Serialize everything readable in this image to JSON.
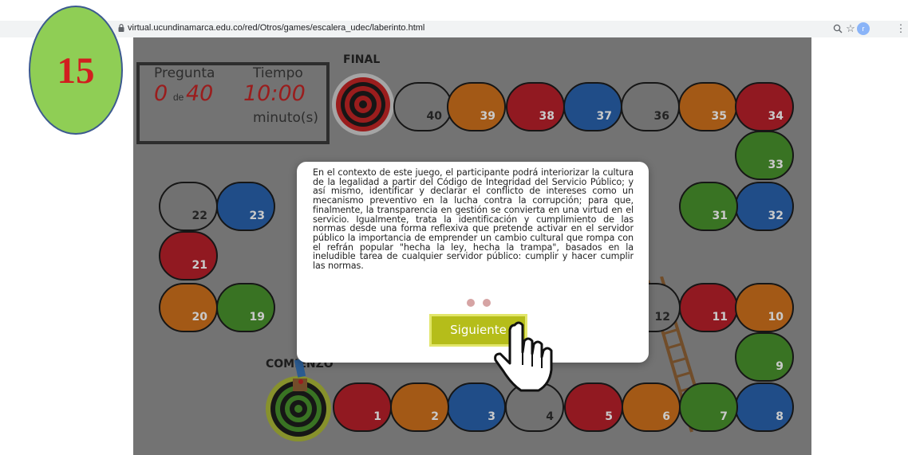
{
  "browser": {
    "url": "virtual.ucundinamarca.edu.co/red/Otros/games/escalera_udec/laberinto.html",
    "avatar_letter": "r"
  },
  "step_badge": "15",
  "scoreboard": {
    "pregunta_label": "Pregunta",
    "tiempo_label": "Tiempo",
    "current_question": "0",
    "de": "de",
    "total_questions": "40",
    "time": "10:00",
    "time_unit": "minuto(s)"
  },
  "board": {
    "final_label": "FINAL",
    "comienzo_label": "COMIENZO",
    "colors": {
      "red": "#b5141f",
      "orange": "#cc6a10",
      "blue": "#1e5aa8",
      "green": "#3f8c22",
      "gray": "#8a8a8a"
    },
    "cells": [
      {
        "n": "40",
        "c": "gray"
      },
      {
        "n": "39",
        "c": "orange"
      },
      {
        "n": "38",
        "c": "red"
      },
      {
        "n": "37",
        "c": "blue"
      },
      {
        "n": "36",
        "c": "gray"
      },
      {
        "n": "35",
        "c": "orange"
      },
      {
        "n": "34",
        "c": "red"
      },
      {
        "n": "33",
        "c": "green"
      },
      {
        "n": "32",
        "c": "blue"
      },
      {
        "n": "31",
        "c": "green"
      },
      {
        "n": "23",
        "c": "blue"
      },
      {
        "n": "22",
        "c": "gray"
      },
      {
        "n": "21",
        "c": "red"
      },
      {
        "n": "20",
        "c": "orange"
      },
      {
        "n": "19",
        "c": "green"
      },
      {
        "n": "12",
        "c": "gray"
      },
      {
        "n": "11",
        "c": "red"
      },
      {
        "n": "10",
        "c": "orange"
      },
      {
        "n": "9",
        "c": "green"
      },
      {
        "n": "8",
        "c": "blue"
      },
      {
        "n": "7",
        "c": "green"
      },
      {
        "n": "6",
        "c": "orange"
      },
      {
        "n": "5",
        "c": "red"
      },
      {
        "n": "4",
        "c": "gray"
      },
      {
        "n": "3",
        "c": "blue"
      },
      {
        "n": "2",
        "c": "orange"
      },
      {
        "n": "1",
        "c": "red"
      }
    ]
  },
  "modal": {
    "text": "En el contexto de este juego, el participante podrá interiorizar la cultura de la legalidad a partir del Código de Integridad del Servicio Público; y así mismo, identificar y declarar el conflicto de intereses como un mecanismo preventivo en la lucha contra la corrupción; para que, finalmente, la transparencia en gestión se convierta en una virtud en el servicio. Igualmente, trata la identificación y cumplimiento de las normas desde una forma reflexiva que pretende activar en el servidor público la importancia de emprender un cambio cultural que rompa con el refrán popular \"hecha la ley, hecha la trampa\", basados en la ineludible tarea de cualquier servidor público: cumplir y hacer cumplir las normas.",
    "next_label": "Siguiente"
  }
}
